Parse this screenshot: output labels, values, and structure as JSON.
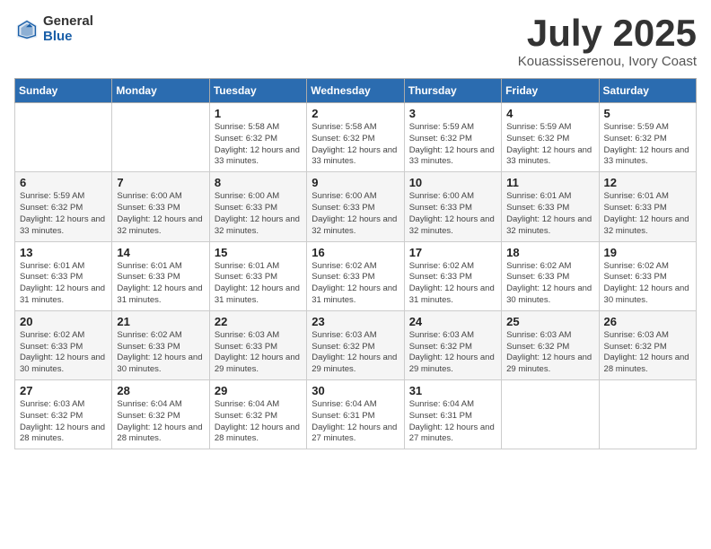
{
  "header": {
    "logo_general": "General",
    "logo_blue": "Blue",
    "month_title": "July 2025",
    "location": "Kouassisserenou, Ivory Coast"
  },
  "weekdays": [
    "Sunday",
    "Monday",
    "Tuesday",
    "Wednesday",
    "Thursday",
    "Friday",
    "Saturday"
  ],
  "weeks": [
    [
      {
        "day": "",
        "info": ""
      },
      {
        "day": "",
        "info": ""
      },
      {
        "day": "1",
        "info": "Sunrise: 5:58 AM\nSunset: 6:32 PM\nDaylight: 12 hours and 33 minutes."
      },
      {
        "day": "2",
        "info": "Sunrise: 5:58 AM\nSunset: 6:32 PM\nDaylight: 12 hours and 33 minutes."
      },
      {
        "day": "3",
        "info": "Sunrise: 5:59 AM\nSunset: 6:32 PM\nDaylight: 12 hours and 33 minutes."
      },
      {
        "day": "4",
        "info": "Sunrise: 5:59 AM\nSunset: 6:32 PM\nDaylight: 12 hours and 33 minutes."
      },
      {
        "day": "5",
        "info": "Sunrise: 5:59 AM\nSunset: 6:32 PM\nDaylight: 12 hours and 33 minutes."
      }
    ],
    [
      {
        "day": "6",
        "info": "Sunrise: 5:59 AM\nSunset: 6:32 PM\nDaylight: 12 hours and 33 minutes."
      },
      {
        "day": "7",
        "info": "Sunrise: 6:00 AM\nSunset: 6:33 PM\nDaylight: 12 hours and 32 minutes."
      },
      {
        "day": "8",
        "info": "Sunrise: 6:00 AM\nSunset: 6:33 PM\nDaylight: 12 hours and 32 minutes."
      },
      {
        "day": "9",
        "info": "Sunrise: 6:00 AM\nSunset: 6:33 PM\nDaylight: 12 hours and 32 minutes."
      },
      {
        "day": "10",
        "info": "Sunrise: 6:00 AM\nSunset: 6:33 PM\nDaylight: 12 hours and 32 minutes."
      },
      {
        "day": "11",
        "info": "Sunrise: 6:01 AM\nSunset: 6:33 PM\nDaylight: 12 hours and 32 minutes."
      },
      {
        "day": "12",
        "info": "Sunrise: 6:01 AM\nSunset: 6:33 PM\nDaylight: 12 hours and 32 minutes."
      }
    ],
    [
      {
        "day": "13",
        "info": "Sunrise: 6:01 AM\nSunset: 6:33 PM\nDaylight: 12 hours and 31 minutes."
      },
      {
        "day": "14",
        "info": "Sunrise: 6:01 AM\nSunset: 6:33 PM\nDaylight: 12 hours and 31 minutes."
      },
      {
        "day": "15",
        "info": "Sunrise: 6:01 AM\nSunset: 6:33 PM\nDaylight: 12 hours and 31 minutes."
      },
      {
        "day": "16",
        "info": "Sunrise: 6:02 AM\nSunset: 6:33 PM\nDaylight: 12 hours and 31 minutes."
      },
      {
        "day": "17",
        "info": "Sunrise: 6:02 AM\nSunset: 6:33 PM\nDaylight: 12 hours and 31 minutes."
      },
      {
        "day": "18",
        "info": "Sunrise: 6:02 AM\nSunset: 6:33 PM\nDaylight: 12 hours and 30 minutes."
      },
      {
        "day": "19",
        "info": "Sunrise: 6:02 AM\nSunset: 6:33 PM\nDaylight: 12 hours and 30 minutes."
      }
    ],
    [
      {
        "day": "20",
        "info": "Sunrise: 6:02 AM\nSunset: 6:33 PM\nDaylight: 12 hours and 30 minutes."
      },
      {
        "day": "21",
        "info": "Sunrise: 6:02 AM\nSunset: 6:33 PM\nDaylight: 12 hours and 30 minutes."
      },
      {
        "day": "22",
        "info": "Sunrise: 6:03 AM\nSunset: 6:33 PM\nDaylight: 12 hours and 29 minutes."
      },
      {
        "day": "23",
        "info": "Sunrise: 6:03 AM\nSunset: 6:32 PM\nDaylight: 12 hours and 29 minutes."
      },
      {
        "day": "24",
        "info": "Sunrise: 6:03 AM\nSunset: 6:32 PM\nDaylight: 12 hours and 29 minutes."
      },
      {
        "day": "25",
        "info": "Sunrise: 6:03 AM\nSunset: 6:32 PM\nDaylight: 12 hours and 29 minutes."
      },
      {
        "day": "26",
        "info": "Sunrise: 6:03 AM\nSunset: 6:32 PM\nDaylight: 12 hours and 28 minutes."
      }
    ],
    [
      {
        "day": "27",
        "info": "Sunrise: 6:03 AM\nSunset: 6:32 PM\nDaylight: 12 hours and 28 minutes."
      },
      {
        "day": "28",
        "info": "Sunrise: 6:04 AM\nSunset: 6:32 PM\nDaylight: 12 hours and 28 minutes."
      },
      {
        "day": "29",
        "info": "Sunrise: 6:04 AM\nSunset: 6:32 PM\nDaylight: 12 hours and 28 minutes."
      },
      {
        "day": "30",
        "info": "Sunrise: 6:04 AM\nSunset: 6:31 PM\nDaylight: 12 hours and 27 minutes."
      },
      {
        "day": "31",
        "info": "Sunrise: 6:04 AM\nSunset: 6:31 PM\nDaylight: 12 hours and 27 minutes."
      },
      {
        "day": "",
        "info": ""
      },
      {
        "day": "",
        "info": ""
      }
    ]
  ]
}
